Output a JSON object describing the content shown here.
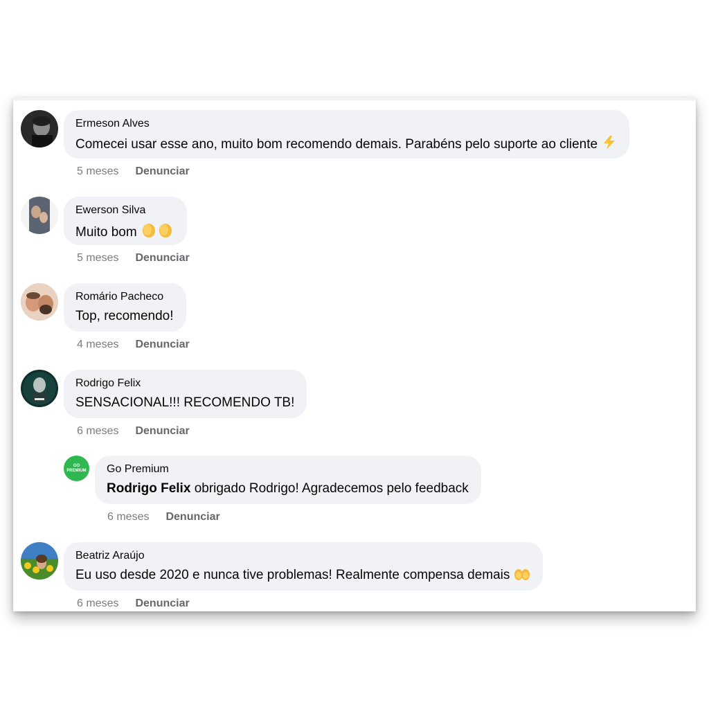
{
  "comments": [
    {
      "author": "Ermeson Alves",
      "text": "Comecei usar esse ano, muito bom recomendo demais. Parabéns pelo suporte ao cliente",
      "emoji": "lightning-icon",
      "time": "5 meses",
      "report": "Denunciar"
    },
    {
      "author": "Ewerson Silva",
      "text": "Muito bom",
      "emoji": "clapping-hands-icon",
      "time": "5 meses",
      "report": "Denunciar"
    },
    {
      "author": "Romário Pacheco",
      "text": "Top, recomendo!",
      "time": "4 meses",
      "report": "Denunciar"
    },
    {
      "author": "Rodrigo Felix",
      "text": "SENSACIONAL!!! RECOMENDO TB!",
      "time": "6 meses",
      "report": "Denunciar"
    },
    {
      "author": "Go Premium",
      "mention": "Rodrigo Felix",
      "text": "obrigado Rodrigo! Agradecemos pelo feedback",
      "time": "6 meses",
      "report": "Denunciar",
      "avatar_text": "GO PREMIUM"
    },
    {
      "author": "Beatriz Araújo",
      "text": "Eu uso desde 2020 e nunca tive problemas! Realmente compensa demais",
      "emoji": "raising-hands-icon",
      "time": "6 meses",
      "report": "Denunciar"
    }
  ],
  "colors": {
    "bubble": "#f0f2f5",
    "meta": "#65676b",
    "brand_green": "#2fb84f"
  }
}
